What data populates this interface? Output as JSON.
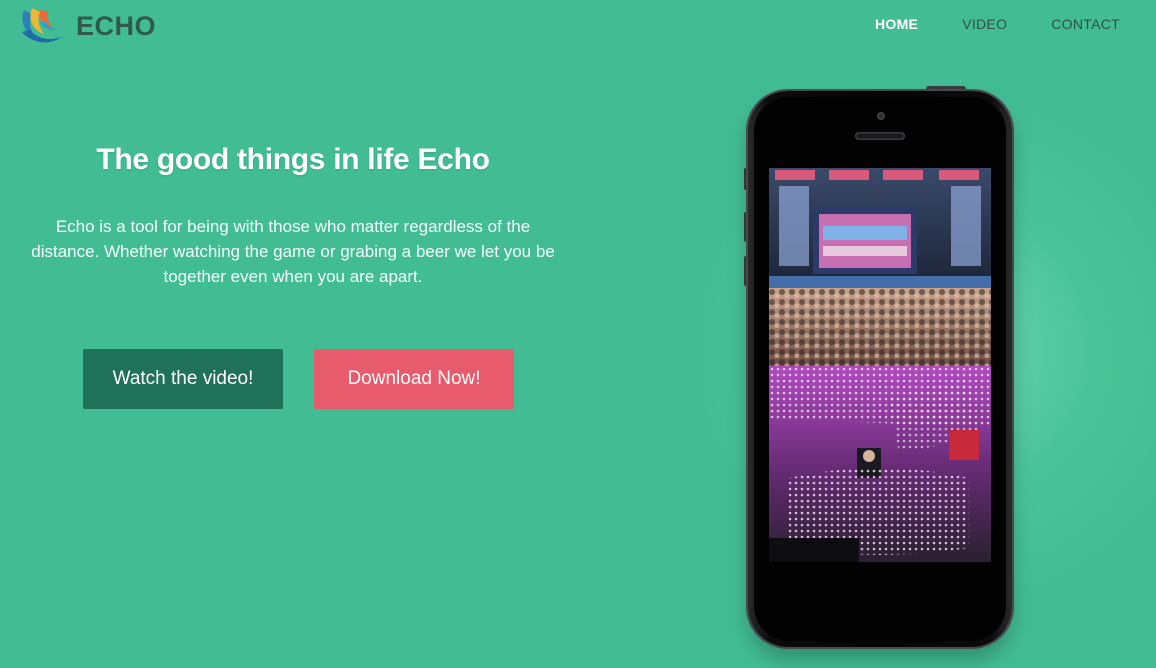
{
  "header": {
    "brand": "ECHO",
    "nav": [
      {
        "label": "HOME",
        "active": true
      },
      {
        "label": "VIDEO",
        "active": false
      },
      {
        "label": "CONTACT",
        "active": false
      }
    ]
  },
  "hero": {
    "title": "The good things in life Echo",
    "description": "Echo is a tool for being with those who matter regardless of the distance. Whether watching the game or grabing a beer we let you be together even when you are apart.",
    "watch_button": "Watch the video!",
    "download_button": "Download Now!"
  },
  "colors": {
    "background": "#42bd93",
    "watch_button": "#1f7157",
    "download_button": "#e85b6c",
    "logo_text": "#2f5a4c",
    "nav_text": "#2f4f45"
  },
  "icons": {
    "logo": "echo-swirl-logo",
    "phone_screen": "concert-photo"
  }
}
